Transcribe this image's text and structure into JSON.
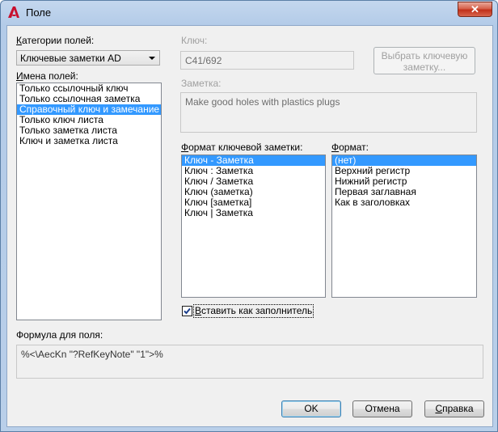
{
  "window": {
    "title": "Поле",
    "close_symbol": "✕"
  },
  "categories": {
    "label_prefix": "К",
    "label_rest": "атегории полей:",
    "selected": "Ключевые заметки AD"
  },
  "field_names": {
    "label_prefix": "И",
    "label_rest": "мена полей:",
    "items": [
      "Только ссылочный ключ",
      "Только ссылочная заметка",
      "Справочный ключ и замечание",
      "Только ключ листа",
      "Только заметка листа",
      "Ключ и заметка листа"
    ],
    "selected_index": 2
  },
  "key": {
    "label": "Ключ:",
    "value": "C41/692"
  },
  "select_key_button": {
    "label": "Выбрать ключевую заметку..."
  },
  "note": {
    "label": "Заметка:",
    "value": "Make good holes with plastics plugs"
  },
  "keynote_format": {
    "label_prefix": "Ф",
    "label_rest": "ормат ключевой заметки:",
    "items": [
      "Ключ - Заметка",
      "Ключ : Заметка",
      "Ключ / Заметка",
      "Ключ (заметка)",
      "Ключ [заметка]",
      "Ключ | Заметка"
    ],
    "selected_index": 0
  },
  "format": {
    "label_prefix": "Ф",
    "label_rest": "ормат:",
    "items": [
      "(нет)",
      "Верхний регистр",
      "Нижний регистр",
      "Первая заглавная",
      "Как в заголовках"
    ],
    "selected_index": 0
  },
  "placeholder_checkbox": {
    "label_prefix": "В",
    "label_rest": "ставить как заполнитель",
    "checked": true
  },
  "formula": {
    "label": "Формула для поля:",
    "value": "%<\\AecKn \"?RefKeyNote\" \"1\">%"
  },
  "buttons": {
    "ok": "OK",
    "cancel": "Отмена",
    "help_prefix": "С",
    "help_rest": "правка"
  },
  "colors": {
    "selection": "#3399ff",
    "title_gradient": "#b9cfe9",
    "close_button": "#c1301a"
  }
}
